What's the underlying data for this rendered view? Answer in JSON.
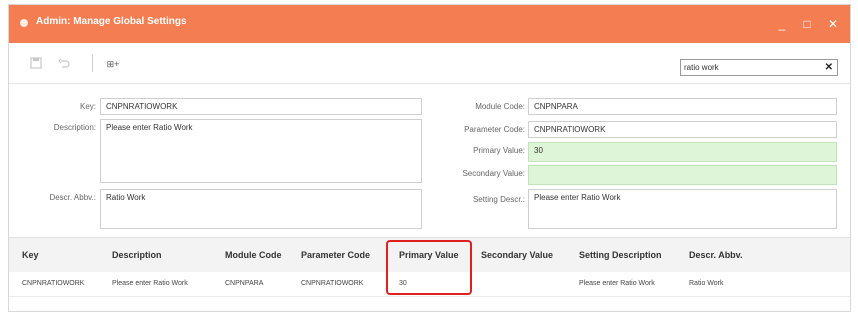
{
  "window": {
    "title": "Admin: Manage Global Settings",
    "accent_color": "#f47d52",
    "controls": {
      "minimize": "_",
      "maximize": "□",
      "close": "✕"
    }
  },
  "toolbar": {
    "icons": [
      "save-icon",
      "undo-icon",
      "column-chooser-icon"
    ],
    "column_chooser_glyph": "⊞+",
    "search": {
      "value": "ratio work",
      "clear_glyph": "✕"
    }
  },
  "form": {
    "key": {
      "label": "Key:",
      "value": "CNPNRATIOWORK"
    },
    "description": {
      "label": "Description:",
      "value": "Please enter Ratio Work"
    },
    "descr_abbv": {
      "label": "Descr. Abbv.:",
      "value": "Ratio Work"
    },
    "module_code": {
      "label": "Module Code:",
      "value": "CNPNPARA"
    },
    "parameter_code": {
      "label": "Parameter Code:",
      "value": "CNPNRATIOWORK"
    },
    "primary_value": {
      "label": "Primary Value:",
      "value": "30"
    },
    "secondary_value": {
      "label": "Secondary Value:",
      "value": ""
    },
    "setting_descr": {
      "label": "Setting Descr.:",
      "value": "Please enter Ratio Work"
    },
    "edited_field_color": "#dff5d8"
  },
  "grid": {
    "columns": [
      "Key",
      "Description",
      "Module Code",
      "Parameter Code",
      "Primary Value",
      "Secondary Value",
      "Setting Description",
      "Descr. Abbv."
    ],
    "rows": [
      [
        "CNPNRATIOWORK",
        "Please enter Ratio Work",
        "CNPNPARA",
        "CNPNRATIOWORK",
        "30",
        "",
        "Please enter Ratio Work",
        "Ratio Work"
      ]
    ],
    "highlight_color": "#e02020"
  }
}
